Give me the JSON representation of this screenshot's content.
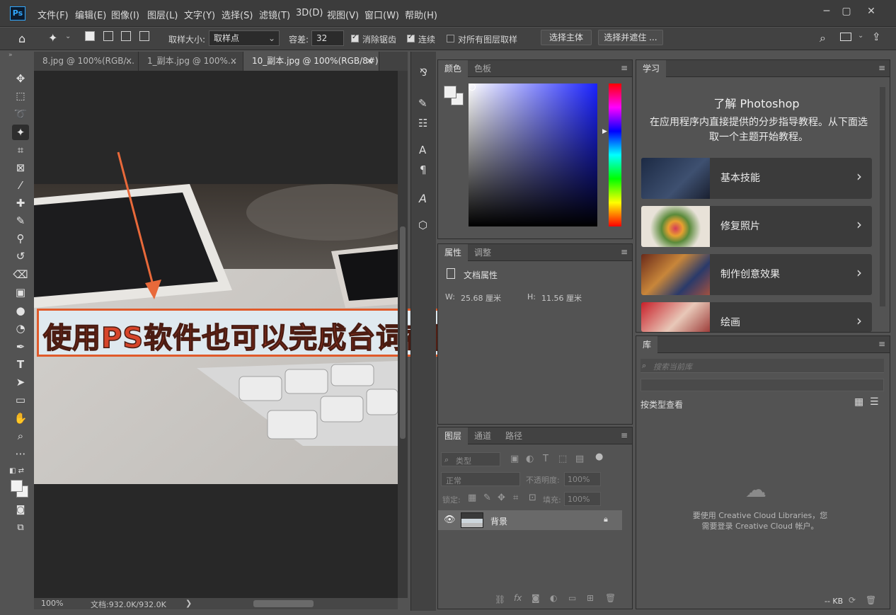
{
  "app": {
    "logo": "Ps"
  },
  "menubar": {
    "items": [
      "文件(F)",
      "编辑(E)",
      "图像(I)",
      "图层(L)",
      "文字(Y)",
      "选择(S)",
      "滤镜(T)",
      "3D(D)",
      "视图(V)",
      "窗口(W)",
      "帮助(H)"
    ]
  },
  "options": {
    "sample_size_label": "取样大小:",
    "sample_size_value": "取样点",
    "tolerance_label": "容差:",
    "tolerance_value": "32",
    "antialias_label": "消除锯齿",
    "contiguous_label": "连续",
    "all_layers_label": "对所有图层取样",
    "select_subject": "选择主体",
    "select_mask": "选择并遮住 ..."
  },
  "tabs": [
    {
      "label": "8.jpg @ 100%(RGB/...",
      "close": "×"
    },
    {
      "label": "1_副本.jpg @ 100%...",
      "close": "×"
    },
    {
      "label": "10_副本.jpg @ 100%(RGB/8#)",
      "close": "×"
    }
  ],
  "canvas": {
    "caption": "使用PS软件也可以完成台词截图的拼接"
  },
  "status": {
    "zoom": "100%",
    "doc": "文档:932.0K/932.0K",
    "arrow": "❯"
  },
  "color_panel": {
    "tabs": [
      "颜色",
      "色板"
    ]
  },
  "properties_panel": {
    "tabs": [
      "属性",
      "调整"
    ],
    "title": "文档属性",
    "w_label": "W:",
    "w_value": "25.68 厘米",
    "h_label": "H:",
    "h_value": "11.56 厘米"
  },
  "layers_panel": {
    "tabs": [
      "图层",
      "通道",
      "路径"
    ],
    "filter_label": "类型",
    "blend_mode": "正常",
    "opacity_label": "不透明度:",
    "opacity_value": "100%",
    "lock_label": "锁定:",
    "fill_label": "填充:",
    "fill_value": "100%",
    "layers": [
      {
        "name": "背景"
      }
    ]
  },
  "learn_panel": {
    "tab": "学习",
    "title": "了解 Photoshop",
    "description": "在应用程序内直接提供的分步指导教程。从下面选取一个主题开始教程。",
    "cards": [
      {
        "label": "基本技能",
        "icon": "chevron-right"
      },
      {
        "label": "修复照片",
        "icon": "chevron-right"
      },
      {
        "label": "制作创意效果",
        "icon": "chevron-right"
      },
      {
        "label": "绘画",
        "icon": "chevron-right"
      }
    ]
  },
  "library_panel": {
    "tab": "库",
    "search_placeholder": "搜索当前库",
    "view_by": "按类型查看",
    "message_line1": "要使用 Creative Cloud Libraries，您",
    "message_line2": "需要登录 Creative Cloud 帐户。",
    "size": "-- KB"
  },
  "colors": {
    "accent_caption_border": "#e05a2a",
    "caption_text": "#d6452a",
    "arrow": "#e8693a"
  }
}
